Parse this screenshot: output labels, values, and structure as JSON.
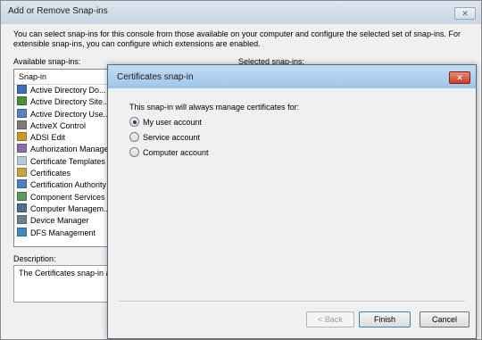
{
  "outer": {
    "title": "Add or Remove Snap-ins",
    "close": "✕",
    "intro": "You can select snap-ins for this console from those available on your computer and configure the selected set of snap-ins. For extensible snap-ins, you can configure which extensions are enabled.",
    "available_label": "Available snap-ins:",
    "selected_label": "Selected snap-ins:",
    "list_header": "Snap-in",
    "items": [
      {
        "label": "Active Directory Do...",
        "icon": "ad-domains-icon"
      },
      {
        "label": "Active Directory Site...",
        "icon": "ad-sites-icon"
      },
      {
        "label": "Active Directory Use...",
        "icon": "ad-users-icon"
      },
      {
        "label": "ActiveX Control",
        "icon": "activex-icon"
      },
      {
        "label": "ADSI Edit",
        "icon": "adsi-edit-icon"
      },
      {
        "label": "Authorization Manager",
        "icon": "authorization-icon"
      },
      {
        "label": "Certificate Templates",
        "icon": "cert-templates-icon"
      },
      {
        "label": "Certificates",
        "icon": "certificates-icon"
      },
      {
        "label": "Certification Authority",
        "icon": "cert-authority-icon"
      },
      {
        "label": "Component Services",
        "icon": "component-services-icon"
      },
      {
        "label": "Computer Managem...",
        "icon": "computer-management-icon"
      },
      {
        "label": "Device Manager",
        "icon": "device-manager-icon"
      },
      {
        "label": "DFS Management",
        "icon": "dfs-icon"
      }
    ],
    "description_label": "Description:",
    "description_text": "The Certificates snap-in allo"
  },
  "inner": {
    "title": "Certificates snap-in",
    "close": "✕",
    "prompt": "This snap-in will always manage certificates for:",
    "options": [
      {
        "label": "My user account",
        "selected": true
      },
      {
        "label": "Service account",
        "selected": false
      },
      {
        "label": "Computer account",
        "selected": false
      }
    ],
    "buttons": {
      "back": "< Back",
      "finish": "Finish",
      "cancel": "Cancel"
    }
  }
}
